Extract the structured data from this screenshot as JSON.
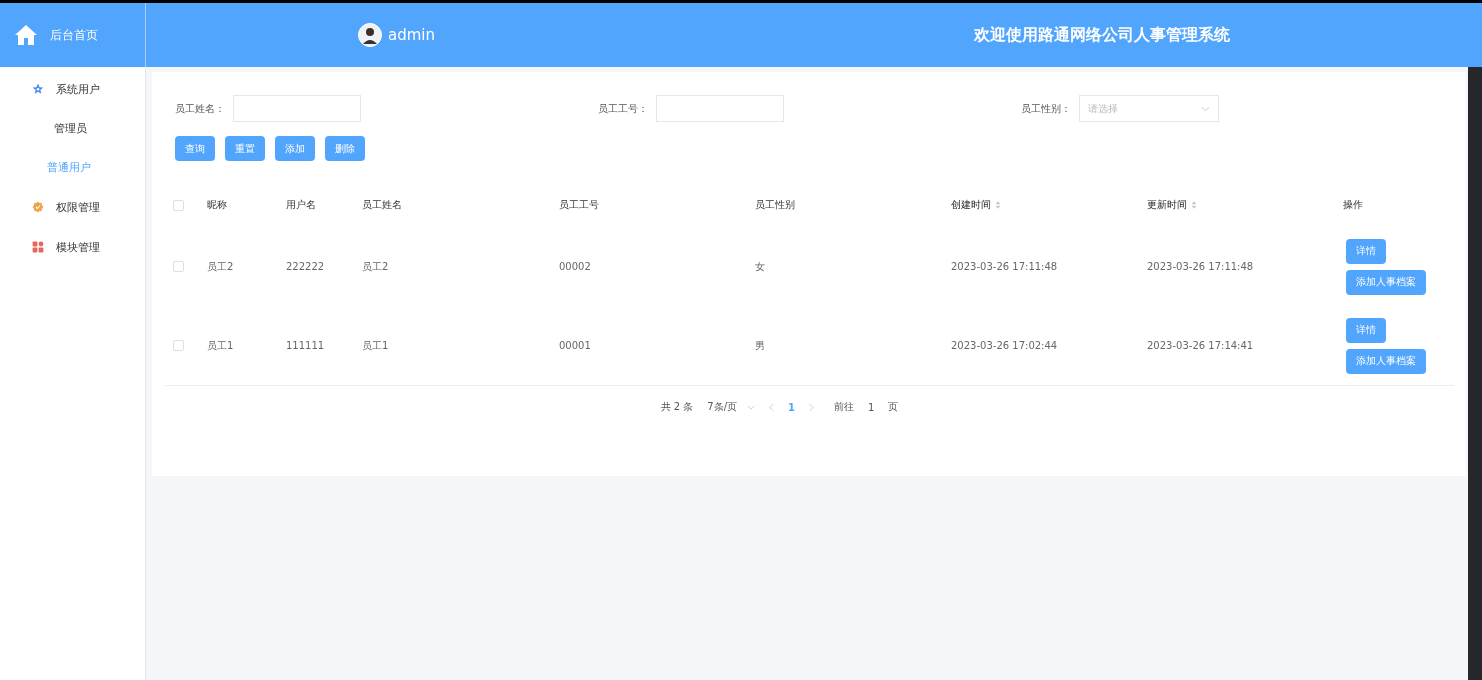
{
  "sidebar": {
    "home": {
      "label": "后台首页"
    },
    "items": [
      {
        "label": "系统用户",
        "children": [
          {
            "label": "管理员",
            "selected": false
          },
          {
            "label": "普通用户",
            "selected": true
          }
        ]
      },
      {
        "label": "权限管理"
      },
      {
        "label": "模块管理"
      }
    ]
  },
  "header": {
    "user": "admin",
    "title": "欢迎使用路通网络公司人事管理系统"
  },
  "filters": [
    {
      "label": "员工姓名：",
      "kind": "text"
    },
    {
      "label": "员工工号：",
      "kind": "text"
    },
    {
      "label": "员工性别：",
      "kind": "select",
      "placeholder": "请选择"
    }
  ],
  "actions": [
    "查询",
    "重置",
    "添加",
    "删除"
  ],
  "table": {
    "select_all": {
      "checked": false
    },
    "columns": [
      {
        "label": "昵称",
        "sortable": false
      },
      {
        "label": "用户名",
        "sortable": false
      },
      {
        "label": "员工姓名",
        "sortable": false
      },
      {
        "label": "员工工号",
        "sortable": false
      },
      {
        "label": "员工性别",
        "sortable": false
      },
      {
        "label": "创建时间",
        "sortable": true
      },
      {
        "label": "更新时间",
        "sortable": true
      },
      {
        "label": "操作",
        "sortable": false
      }
    ],
    "rows": [
      {
        "checked": false,
        "cells": [
          "员工2",
          "222222",
          "员工2",
          "00002",
          "女",
          "2023-03-26 17:11:48",
          "2023-03-26 17:11:48"
        ],
        "buttons": [
          "详情",
          "添加人事档案"
        ]
      },
      {
        "checked": false,
        "cells": [
          "员工1",
          "111111",
          "员工1",
          "00001",
          "男",
          "2023-03-26 17:02:44",
          "2023-03-26 17:14:41"
        ],
        "buttons": [
          "详情",
          "添加人事档案"
        ]
      }
    ]
  },
  "pagination": {
    "total": "共 2 条",
    "page_size": "7条/页",
    "pages": [
      {
        "label": "1",
        "selected": true
      }
    ],
    "goto_label": "前往",
    "goto_value": "1",
    "goto_suffix": "页"
  }
}
